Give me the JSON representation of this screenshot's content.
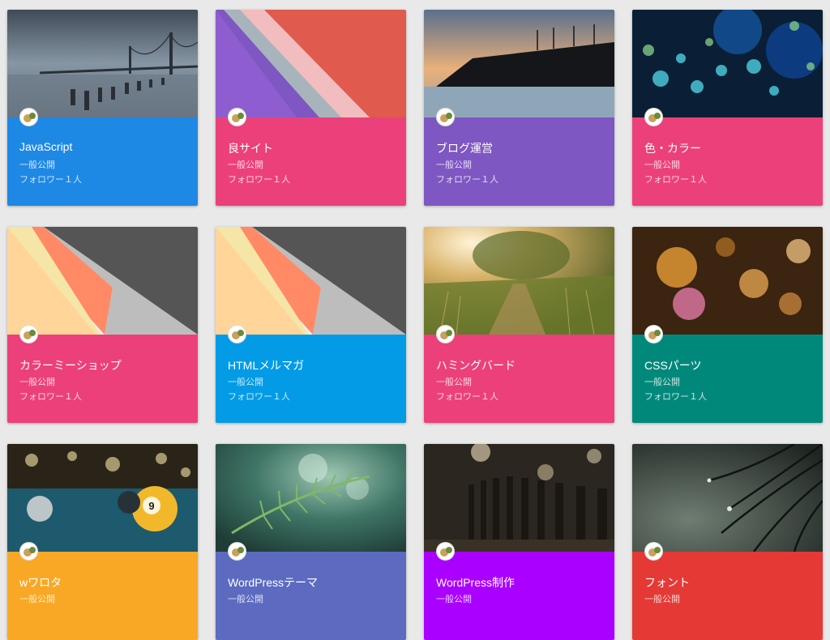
{
  "boards": [
    {
      "title": "JavaScript",
      "visibility": "一般公開",
      "followers": "フォロワー１人",
      "color": "#1e88e5",
      "image": "bay-bridge-pier-photo"
    },
    {
      "title": "良サイト",
      "visibility": "一般公開",
      "followers": "フォロワー１人",
      "color": "#ec407a",
      "image": "material-stripes-pattern"
    },
    {
      "title": "ブログ運営",
      "visibility": "一般公開",
      "followers": "フォロワー１人",
      "color": "#7e57c2",
      "image": "bridge-sunset-photo"
    },
    {
      "title": "色・カラー",
      "visibility": "一般公開",
      "followers": "フォロワー１人",
      "color": "#ec407a",
      "image": "blue-bokeh-photo"
    },
    {
      "title": "カラーミーショップ",
      "visibility": "一般公開",
      "followers": "フォロワー１人",
      "color": "#ec407a",
      "image": "material-triangles-pattern"
    },
    {
      "title": "HTMLメルマガ",
      "visibility": "一般公開",
      "followers": "フォロワー１人",
      "color": "#039be5",
      "image": "material-triangles-pattern"
    },
    {
      "title": "ハミングバード",
      "visibility": "一般公開",
      "followers": "フォロワー１人",
      "color": "#ec407a",
      "image": "grass-path-sunset-photo"
    },
    {
      "title": "CSSパーツ",
      "visibility": "一般公開",
      "followers": "フォロワー１人",
      "color": "#00897b",
      "image": "warm-bokeh-photo"
    },
    {
      "title": "wワロタ",
      "visibility": "一般公開",
      "followers": "",
      "color": "#f9a825",
      "image": "billiard-ball-photo"
    },
    {
      "title": "WordPressテーマ",
      "visibility": "一般公開",
      "followers": "",
      "color": "#5c6bc0",
      "image": "fern-leaf-photo"
    },
    {
      "title": "WordPress制作",
      "visibility": "一般公開",
      "followers": "",
      "color": "#aa00ff",
      "image": "fence-bokeh-photo"
    },
    {
      "title": "フォント",
      "visibility": "一般公開",
      "followers": "",
      "color": "#e53935",
      "image": "pine-needles-dew-photo"
    }
  ]
}
